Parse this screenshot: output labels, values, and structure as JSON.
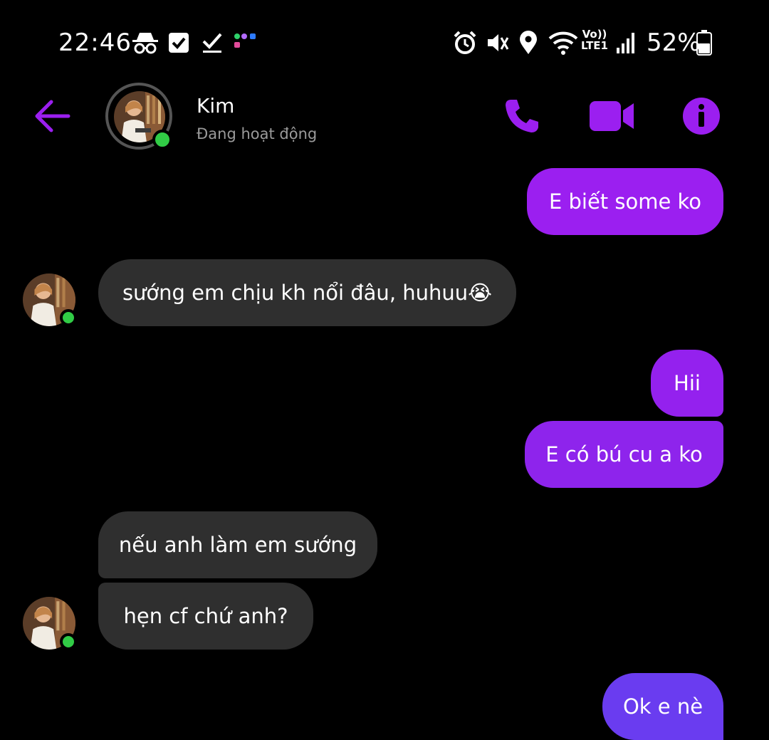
{
  "status_bar": {
    "time": "22:46",
    "battery": "52%",
    "network_top": "Vo))",
    "network_bottom": "LTE1"
  },
  "header": {
    "contact_name": "Kim",
    "contact_status": "Đang hoạt động",
    "accent_color": "#9b1ff0"
  },
  "messages": [
    {
      "side": "out",
      "text": "E biết some ko"
    },
    {
      "side": "in",
      "text": "sướng em chịu kh nổi đâu, huhuu😭"
    },
    {
      "side": "out",
      "text": "Hii"
    },
    {
      "side": "out",
      "text": "E có bú cu a ko"
    },
    {
      "side": "in",
      "text": "nếu anh làm em sướng"
    },
    {
      "side": "in",
      "text": "hẹn cf chứ anh?"
    },
    {
      "side": "out",
      "text": "Ok e nè"
    }
  ]
}
